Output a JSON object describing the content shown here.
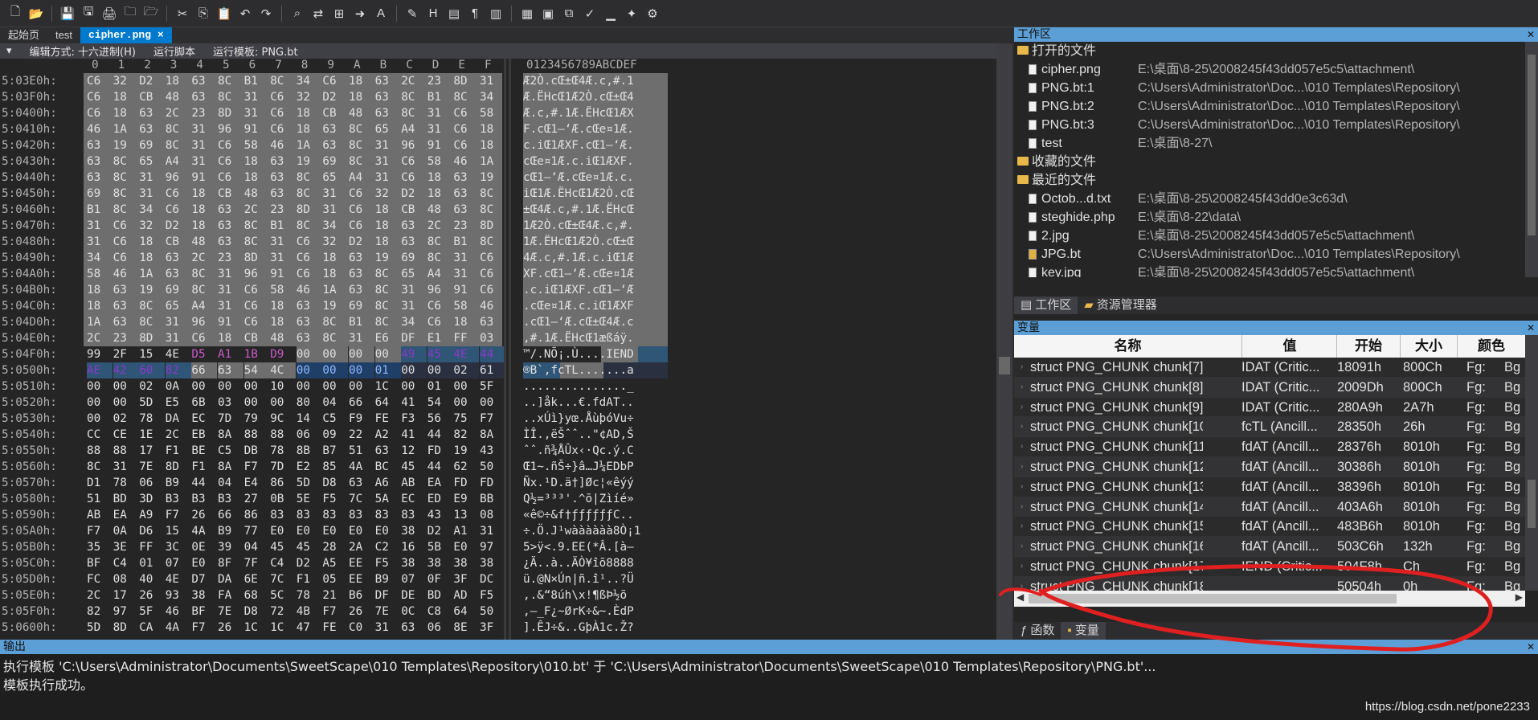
{
  "toolbar": {
    "icons": [
      "new-file-icon",
      "open-icon",
      "save-icon",
      "save-all-icon",
      "print-icon",
      "folder-icon",
      "open-folder-icon",
      "cut-icon",
      "copy-icon",
      "paste-icon",
      "undo-icon",
      "redo-icon",
      "find-icon",
      "find-replace-icon",
      "find-in-files-icon",
      "goto-icon",
      "font-icon",
      "highlight-icon",
      "hex-icon",
      "columns-icon",
      "paragraph-icon",
      "split-icon",
      "view-icon",
      "calculator-icon",
      "compare-icon",
      "checksum-icon",
      "histogram-icon",
      "script-icon",
      "run-icon"
    ]
  },
  "tabs": [
    {
      "label": "起始页",
      "active": false
    },
    {
      "label": "test",
      "active": false
    },
    {
      "label": "cipher.png",
      "active": true
    }
  ],
  "editor": {
    "edit_mode": "编辑方式: 十六进制(H)",
    "run_script": "运行脚本",
    "run_template": "运行模板: PNG.bt",
    "column_header": [
      "0",
      "1",
      "2",
      "3",
      "4",
      "5",
      "6",
      "7",
      "8",
      "9",
      "A",
      "B",
      "C",
      "D",
      "E",
      "F"
    ],
    "ascii_header": "0123456789ABCDEF"
  },
  "hex_rows": [
    {
      "addr": "5:03E0h:",
      "hex": "C6 32 D2 18 63 8C B1 8C 34 C6 18 63 2C 23 8D 31",
      "ascii": "Æ2Ò.cŒ±Œ4Æ.c,#.1",
      "sel": true
    },
    {
      "addr": "5:03F0h:",
      "hex": "C6 18 CB 48 63 8C 31 C6 32 D2 18 63 8C B1 8C 34",
      "ascii": "Æ.ËHcŒ1Æ2Ò.cŒ±Œ4",
      "sel": true
    },
    {
      "addr": "5:0400h:",
      "hex": "C6 18 63 2C 23 8D 31 C6 18 CB 48 63 8C 31 C6 58",
      "ascii": "Æ.c,#.1Æ.ËHcŒ1ÆX",
      "sel": true
    },
    {
      "addr": "5:0410h:",
      "hex": "46 1A 63 8C 31 96 91 C6 18 63 8C 65 A4 31 C6 18",
      "ascii": "F.cŒ1–‘Æ.cŒe¤1Æ.",
      "sel": true
    },
    {
      "addr": "5:0420h:",
      "hex": "63 19 69 8C 31 C6 58 46 1A 63 8C 31 96 91 C6 18",
      "ascii": "c.iŒ1ÆXF.cŒ1–‘Æ.",
      "sel": true
    },
    {
      "addr": "5:0430h:",
      "hex": "63 8C 65 A4 31 C6 18 63 19 69 8C 31 C6 58 46 1A",
      "ascii": "cŒe¤1Æ.c.iŒ1ÆXF.",
      "sel": true
    },
    {
      "addr": "5:0440h:",
      "hex": "63 8C 31 96 91 C6 18 63 8C 65 A4 31 C6 18 63 19",
      "ascii": "cŒ1–‘Æ.cŒe¤1Æ.c.",
      "sel": true
    },
    {
      "addr": "5:0450h:",
      "hex": "69 8C 31 C6 18 CB 48 63 8C 31 C6 32 D2 18 63 8C",
      "ascii": "iŒ1Æ.ËHcŒ1Æ2Ò.cŒ",
      "sel": true
    },
    {
      "addr": "5:0460h:",
      "hex": "B1 8C 34 C6 18 63 2C 23 8D 31 C6 18 CB 48 63 8C",
      "ascii": "±Œ4Æ.c,#.1Æ.ËHcŒ",
      "sel": true
    },
    {
      "addr": "5:0470h:",
      "hex": "31 C6 32 D2 18 63 8C B1 8C 34 C6 18 63 2C 23 8D",
      "ascii": "1Æ2Ò.cŒ±Œ4Æ.c,#.",
      "sel": true
    },
    {
      "addr": "5:0480h:",
      "hex": "31 C6 18 CB 48 63 8C 31 C6 32 D2 18 63 8C B1 8C",
      "ascii": "1Æ.ËHcŒ1Æ2Ò.cŒ±Œ",
      "sel": true
    },
    {
      "addr": "5:0490h:",
      "hex": "34 C6 18 63 2C 23 8D 31 C6 18 63 19 69 8C 31 C6",
      "ascii": "4Æ.c,#.1Æ.c.iŒ1Æ",
      "sel": true
    },
    {
      "addr": "5:04A0h:",
      "hex": "58 46 1A 63 8C 31 96 91 C6 18 63 8C 65 A4 31 C6",
      "ascii": "XF.cŒ1–‘Æ.cŒe¤1Æ",
      "sel": true
    },
    {
      "addr": "5:04B0h:",
      "hex": "18 63 19 69 8C 31 C6 58 46 1A 63 8C 31 96 91 C6",
      "ascii": ".c.iŒ1ÆXF.cŒ1–‘Æ",
      "sel": true
    },
    {
      "addr": "5:04C0h:",
      "hex": "18 63 8C 65 A4 31 C6 18 63 19 69 8C 31 C6 58 46",
      "ascii": ".cŒe¤1Æ.c.iŒ1ÆXF",
      "sel": true
    },
    {
      "addr": "5:04D0h:",
      "hex": "1A 63 8C 31 96 91 C6 18 63 8C B1 8C 34 C6 18 63",
      "ascii": ".cŒ1–‘Æ.cŒ±Œ4Æ.c",
      "sel": true
    },
    {
      "addr": "5:04E0h:",
      "hex": "2C 23 8D 31 C6 18 CB 48 63 8C 31 E6 DF E1 FF 03",
      "ascii": ",#.1Æ.ËHcŒ1æßáÿ.",
      "sel": true
    },
    {
      "addr": "5:04F0h:",
      "hex": "99 2F 15 4E D5 A1 1B D9 00 00 00 00 49 45 4E 44",
      "ascii": "™/.NÕ¡.Ù....IEND",
      "sel": false,
      "special": "iend"
    },
    {
      "addr": "5:0500h:",
      "hex": "AE 42 60 82 66 63 54 4C 00 00 00 01 00 00 02 61",
      "ascii": "®B`‚fcTL.......a",
      "sel": false,
      "special": "fctl"
    },
    {
      "addr": "5:0510h:",
      "hex": "00 00 02 0A 00 00 00 10 00 00 00 1C 00 01 00 5F",
      "ascii": "..............._",
      "sel": false
    },
    {
      "addr": "5:0520h:",
      "hex": "00 00 5D E5 6B 03 00 00 80 04 66 64 41 54 00 00",
      "ascii": "..]åk...€.fdAT..",
      "sel": false
    },
    {
      "addr": "5:0530h:",
      "hex": "00 02 78 DA EC 7D 79 9C 14 C5 F9 FE F3 56 75 F7",
      "ascii": "..xÚì}yœ.ÅùþóVu÷",
      "sel": false
    },
    {
      "addr": "5:0540h:",
      "hex": "CC CE 1E 2C EB 8A 88 88 06 09 22 A2 41 44 82 8A",
      "ascii": "ÌÎ.,ëŠˆˆ..\"¢AD‚Š",
      "sel": false
    },
    {
      "addr": "5:0550h:",
      "hex": "88 88 17 F1 BE C5 DB 78 8B B7 51 63 12 FD 19 43",
      "ascii": "ˆˆ.ñ¾ÅÛx‹·Qc.ý.C",
      "sel": false
    },
    {
      "addr": "5:0560h:",
      "hex": "8C 31 7E 8D F1 8A F7 7D E2 85 4A BC 45 44 62 50",
      "ascii": "Œ1~.ñŠ÷}â…J¼EDbP",
      "sel": false
    },
    {
      "addr": "5:0570h:",
      "hex": "D1 78 06 B9 44 04 E4 86 5D D8 63 A6 AB EA FD FD",
      "ascii": "Ñx.¹D.ä†]Øc¦«êýý",
      "sel": false
    },
    {
      "addr": "5:0580h:",
      "hex": "51 BD 3D B3 B3 B3 27 0B 5E F5 7C 5A EC ED E9 BB",
      "ascii": "Q½=³³³'.^õ|Zìíé»",
      "sel": false
    },
    {
      "addr": "5:0590h:",
      "hex": "AB EA A9 F7 26 66 86 83 83 83 83 83 83 43 13 08",
      "ascii": "«ê©÷&f†ƒƒƒƒƒƒC..",
      "sel": false
    },
    {
      "addr": "5:05A0h:",
      "hex": "F7 0A D6 15 4A B9 77 E0 E0 E0 E0 E0 38 D2 A1 31",
      "ascii": "÷.Ö.J¹wàààààà8Ò¡1",
      "sel": false
    },
    {
      "addr": "5:05B0h:",
      "hex": "35 3E FF 3C 0E 39 04 45 45 28 2A C2 16 5B E0 97",
      "ascii": "5>ÿ<.9.EE(*Â.[à—",
      "sel": false
    },
    {
      "addr": "5:05C0h:",
      "hex": "BF C4 01 07 E0 8F 7F C4 D2 A5 EE F5 38 38 38 38",
      "ascii": "¿Ä..à..ÄÒ¥îõ8888",
      "sel": false
    },
    {
      "addr": "5:05D0h:",
      "hex": "FC 08 40 4E D7 DA 6E 7C F1 05 EE B9 07 0F 3F DC",
      "ascii": "ü.@N×Ún|ñ.î¹..?Ü",
      "sel": false
    },
    {
      "addr": "5:05E0h:",
      "hex": "2C 17 26 93 38 FA 68 5C 78 21 B6 DF DE BD AD F5",
      "ascii": ",.&“8úh\\x!¶ßÞ½­õ",
      "sel": false
    },
    {
      "addr": "5:05F0h:",
      "hex": "82 97 5F 46 BF 7E D8 72 4B F7 26 7E 0C C8 64 50",
      "ascii": "‚—_F¿~ØrK÷&~.ÈdP",
      "sel": false
    },
    {
      "addr": "5:0600h:",
      "hex": "5D 8D CA 4A F7 26 1C 1C 47 FE C0 31 63 06 8E 3F",
      "ascii": "].ÊJ÷&..GþÀ1c.Ž?",
      "sel": false
    }
  ],
  "workspace": {
    "title": "工作区",
    "groups": [
      {
        "label": "打开的文件",
        "items": [
          {
            "name": "cipher.png",
            "path": "E:\\桌面\\8-25\\2008245f43dd057e5c5\\attachment\\"
          },
          {
            "name": "PNG.bt:1",
            "path": "C:\\Users\\Administrator\\Doc...\\010 Templates\\Repository\\"
          },
          {
            "name": "PNG.bt:2",
            "path": "C:\\Users\\Administrator\\Doc...\\010 Templates\\Repository\\"
          },
          {
            "name": "PNG.bt:3",
            "path": "C:\\Users\\Administrator\\Doc...\\010 Templates\\Repository\\"
          },
          {
            "name": "test",
            "path": "E:\\桌面\\8-27\\"
          }
        ]
      },
      {
        "label": "收藏的文件",
        "items": []
      },
      {
        "label": "最近的文件",
        "items": [
          {
            "name": "Octob...d.txt",
            "path": "E:\\桌面\\8-25\\2008245f43dd0e3c63d\\"
          },
          {
            "name": "steghide.php",
            "path": "E:\\桌面\\8-22\\data\\"
          },
          {
            "name": "2.jpg",
            "path": "E:\\桌面\\8-25\\2008245f43dd057e5c5\\attachment\\"
          },
          {
            "name": "JPG.bt",
            "path": "C:\\Users\\Administrator\\Doc...\\010 Templates\\Repository\\"
          },
          {
            "name": "key.jpg",
            "path": "E:\\桌面\\8-25\\2008245f43dd057e5c5\\attachment\\"
          },
          {
            "name": "1.jpg",
            "path": "E:\\桌面\\8-22\\data\\"
          }
        ]
      }
    ],
    "tabs": [
      "工作区",
      "资源管理器"
    ]
  },
  "variables": {
    "title": "变量",
    "columns": [
      "名称",
      "值",
      "开始",
      "大小",
      "颜色"
    ],
    "rows": [
      {
        "name": "struct PNG_CHUNK chunk[7]",
        "value": "IDAT  (Critic...",
        "start": "18091h",
        "size": "800Ch",
        "color": "Fg:",
        "bg": "Bg"
      },
      {
        "name": "struct PNG_CHUNK chunk[8]",
        "value": "IDAT  (Critic...",
        "start": "2009Dh",
        "size": "800Ch",
        "color": "Fg:",
        "bg": "Bg"
      },
      {
        "name": "struct PNG_CHUNK chunk[9]",
        "value": "IDAT  (Critic...",
        "start": "280A9h",
        "size": "2A7h",
        "color": "Fg:",
        "bg": "Bg"
      },
      {
        "name": "struct PNG_CHUNK chunk[10]",
        "value": "fcTL  (Ancill...",
        "start": "28350h",
        "size": "26h",
        "color": "Fg:",
        "bg": "Bg"
      },
      {
        "name": "struct PNG_CHUNK chunk[11]",
        "value": "fdAT  (Ancill...",
        "start": "28376h",
        "size": "8010h",
        "color": "Fg:",
        "bg": "Bg"
      },
      {
        "name": "struct PNG_CHUNK chunk[12]",
        "value": "fdAT  (Ancill...",
        "start": "30386h",
        "size": "8010h",
        "color": "Fg:",
        "bg": "Bg"
      },
      {
        "name": "struct PNG_CHUNK chunk[13]",
        "value": "fdAT  (Ancill...",
        "start": "38396h",
        "size": "8010h",
        "color": "Fg:",
        "bg": "Bg"
      },
      {
        "name": "struct PNG_CHUNK chunk[14]",
        "value": "fdAT  (Ancill...",
        "start": "403A6h",
        "size": "8010h",
        "color": "Fg:",
        "bg": "Bg"
      },
      {
        "name": "struct PNG_CHUNK chunk[15]",
        "value": "fdAT  (Ancill...",
        "start": "483B6h",
        "size": "8010h",
        "color": "Fg:",
        "bg": "Bg"
      },
      {
        "name": "struct PNG_CHUNK chunk[16]",
        "value": "fdAT  (Ancill...",
        "start": "503C6h",
        "size": "132h",
        "color": "Fg:",
        "bg": "Bg"
      },
      {
        "name": "struct PNG_CHUNK chunk[17]",
        "value": "IEND  (Critic...",
        "start": "504F8h",
        "size": "Ch",
        "color": "Fg:",
        "bg": "Bg"
      },
      {
        "name": "struct PNG_CHUNK chunk[18]",
        "value": "",
        "start": "50504h",
        "size": "0h",
        "color": "Fg:",
        "bg": "Bg"
      }
    ],
    "bottom_tabs": [
      "函数",
      "变量"
    ]
  },
  "output": {
    "title": "输出",
    "lines": [
      "执行模板 'C:\\Users\\Administrator\\Documents\\SweetScape\\010 Templates\\Repository\\010.bt' 于 'C:\\Users\\Administrator\\Documents\\SweetScape\\010 Templates\\Repository\\PNG.bt'...",
      "模板执行成功。"
    ]
  },
  "watermark": "https://blog.csdn.net/pone2233",
  "colors": {
    "accent": "#007acc",
    "panel_header": "#5c9fd7",
    "selection": "#6e6e6e",
    "annotation": "#e02020"
  }
}
